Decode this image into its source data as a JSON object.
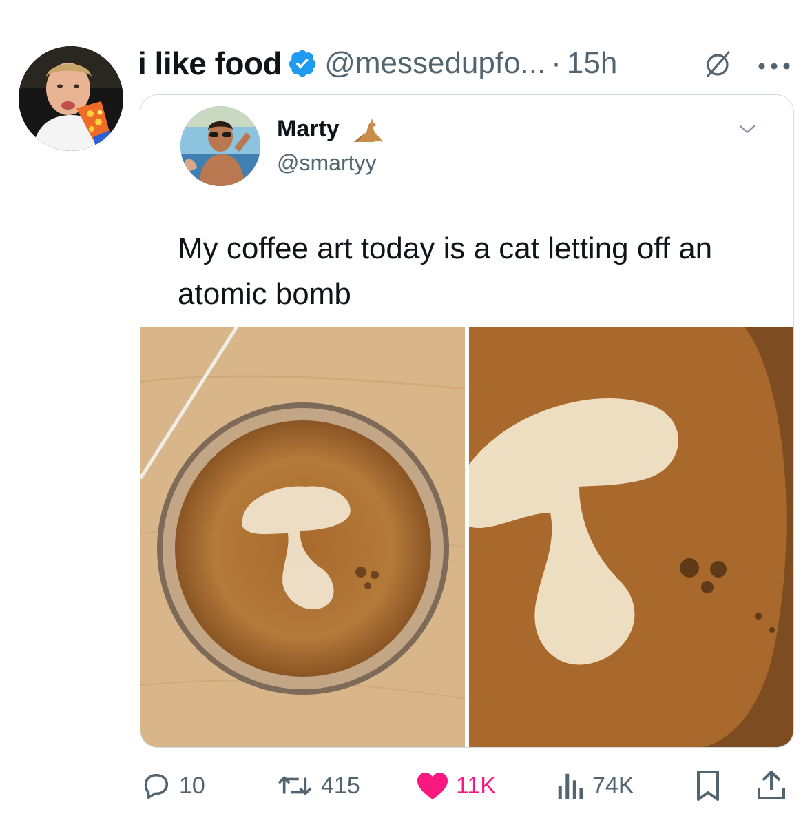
{
  "author": {
    "display_name": "i like food",
    "handle": "@messedupfo...",
    "separator": "·",
    "time": "15h"
  },
  "quoted_post": {
    "display_name": "Marty",
    "emoji": "kangaroo-emoji",
    "handle": "@smartyy",
    "text": "My coffee art today is a cat letting off an atomic bomb",
    "images": [
      "coffee-glass-overhead-photo",
      "coffee-foam-closeup-photo"
    ]
  },
  "actions": {
    "replies": "10",
    "reposts": "415",
    "likes": "11K",
    "views": "74K"
  },
  "colors": {
    "verified_blue": "#1d9bf0",
    "like_pink": "#f91880",
    "secondary_text": "#536471",
    "coffee_crema": "#b57a35",
    "foam": "#f3ead8",
    "wood": "#d8b586"
  },
  "icons": [
    "verified-badge-icon",
    "grok-icon",
    "more-icon",
    "chevron-down-icon",
    "reply-icon",
    "repost-icon",
    "like-icon",
    "views-icon",
    "bookmark-icon",
    "share-icon"
  ]
}
